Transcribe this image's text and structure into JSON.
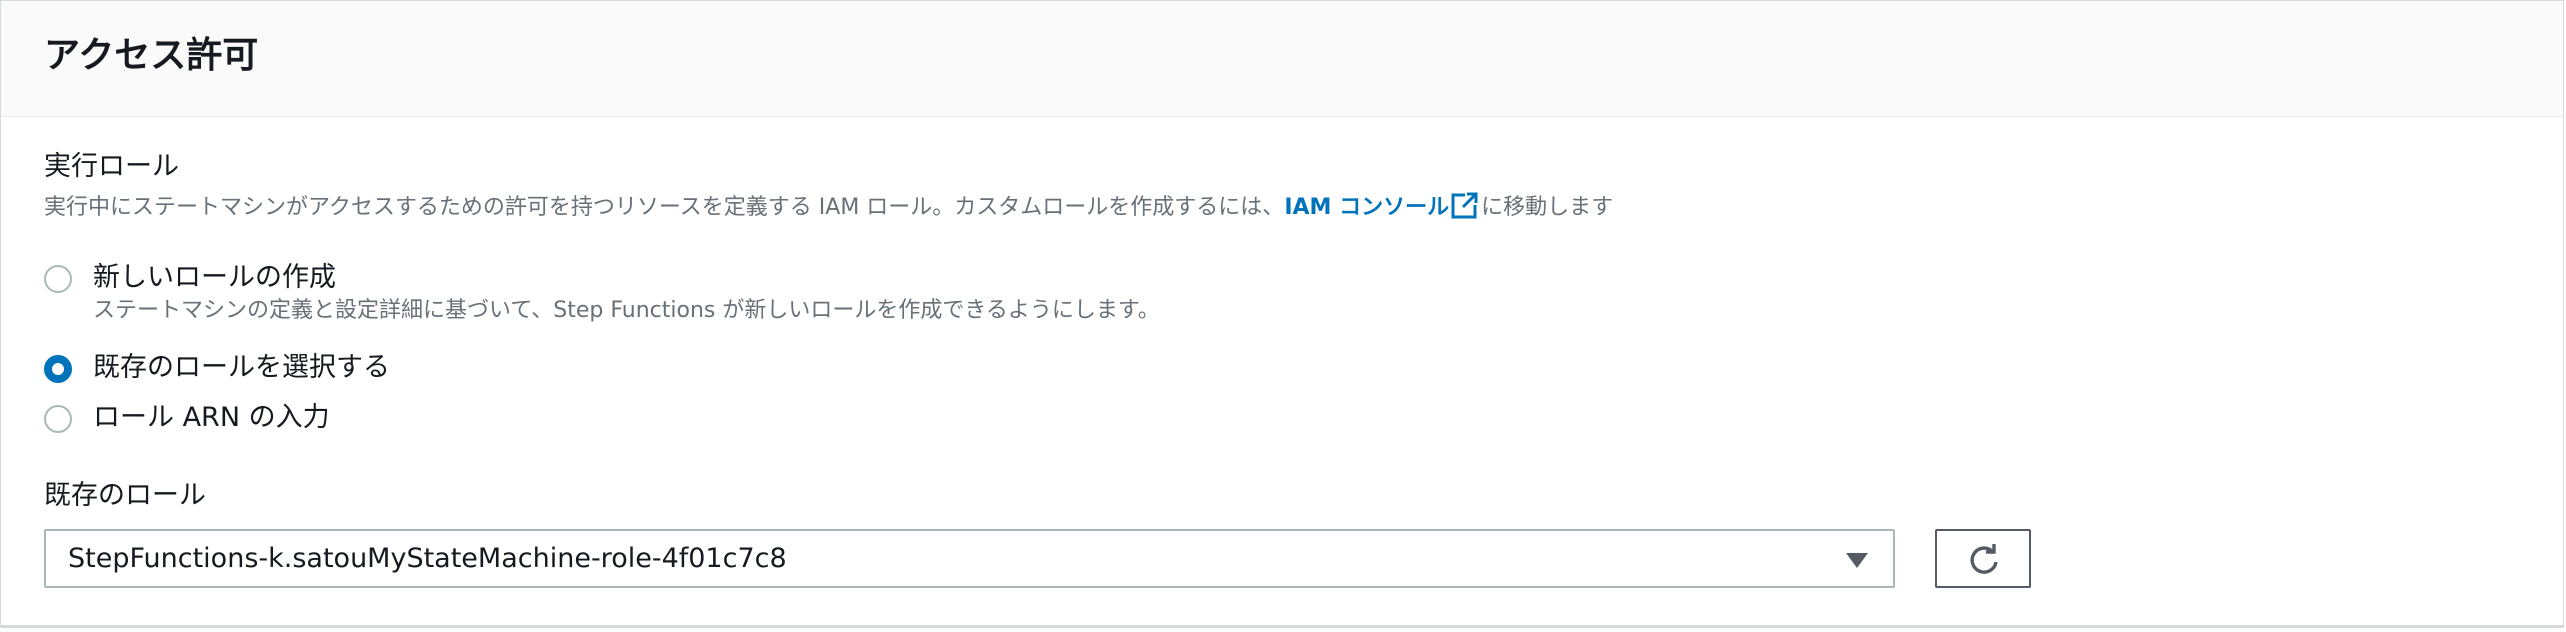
{
  "panel": {
    "title": "アクセス許可"
  },
  "execution_role": {
    "label": "実行ロール",
    "description_prefix": "実行中にステートマシンがアクセスするための許可を持つリソースを定義する IAM ロール。カスタムロールを作成するには、",
    "console_link": "IAM コンソール",
    "description_suffix": "に移動します"
  },
  "role_options": [
    {
      "label": "新しいロールの作成",
      "description": "ステートマシンの定義と設定詳細に基づいて、Step Functions が新しいロールを作成できるようにします。",
      "selected": false
    },
    {
      "label": "既存のロールを選択する",
      "selected": true
    },
    {
      "label": "ロール ARN の入力",
      "selected": false
    }
  ],
  "existing_role": {
    "label": "既存のロール",
    "selected_value": "StepFunctions-k.satouMyStateMachine-role-4f01c7c8"
  },
  "icons": {
    "external_link": "external-link-icon",
    "dropdown": "caret-down-icon",
    "refresh": "refresh-icon"
  },
  "colors": {
    "accent": "#0073bb",
    "text": "#16191f",
    "secondary_text": "#687078",
    "border": "#aab7b8"
  }
}
